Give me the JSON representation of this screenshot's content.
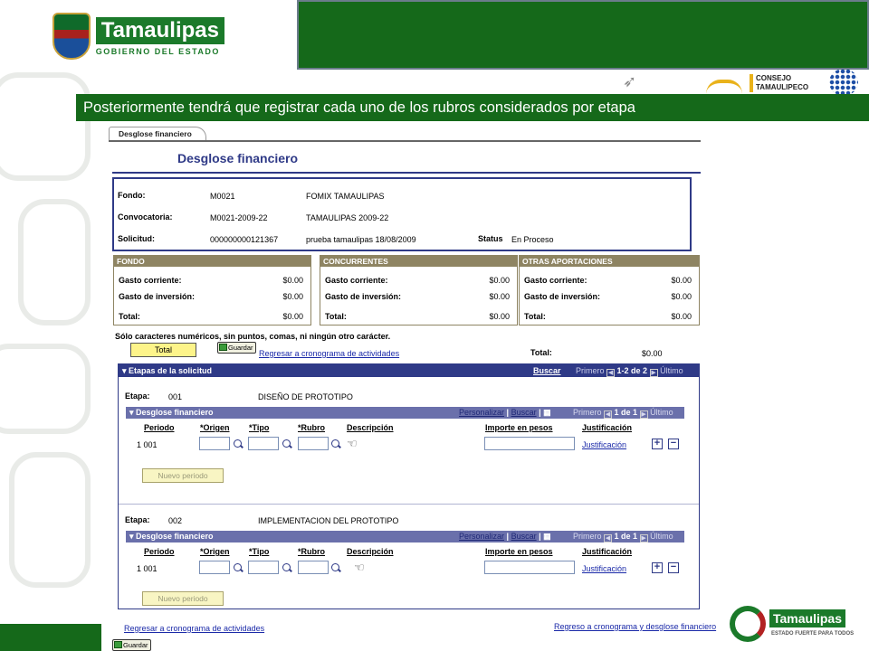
{
  "header": {
    "logo_name": "Tamaulipas",
    "logo_sub": "GOBIERNO DEL ESTADO",
    "sponsor_text": "CONSEJO TAMAULIPECO",
    "banner": "Posteriormente tendrá que registrar cada uno de los rubros considerados por etapa"
  },
  "tab": {
    "label": "Desglose financiero"
  },
  "page": {
    "title": "Desglose financiero"
  },
  "info": {
    "fondo_label": "Fondo:",
    "fondo_code": "M0021",
    "fondo_name": "FOMIX TAMAULIPAS",
    "conv_label": "Convocatoria:",
    "conv_code": "M0021-2009-22",
    "conv_name": "TAMAULIPAS 2009-22",
    "sol_label": "Solicitud:",
    "sol_code": "000000000121367",
    "sol_name": "prueba tamaulipas 18/08/2009",
    "status_label": "Status",
    "status_value": "En Proceso"
  },
  "summaries": [
    {
      "title": "FONDO",
      "gc_label": "Gasto corriente:",
      "gc": "$0.00",
      "gi_label": "Gasto de inversión:",
      "gi": "$0.00",
      "tot_label": "Total:",
      "tot": "$0.00"
    },
    {
      "title": "CONCURRENTES",
      "gc_label": "Gasto corriente:",
      "gc": "$0.00",
      "gi_label": "Gasto de inversión:",
      "gi": "$0.00",
      "tot_label": "Total:",
      "tot": "$0.00"
    },
    {
      "title": "OTRAS APORTACIONES",
      "gc_label": "Gasto corriente:",
      "gc": "$0.00",
      "gi_label": "Gasto de inversión:",
      "gi": "$0.00",
      "tot_label": "Total:",
      "tot": "$0.00"
    }
  ],
  "notice": "Sólo caracteres numéricos, sin puntos, comas, ni ningún otro carácter.",
  "actions": {
    "total_button": "Total",
    "save_button": "Guardar",
    "return_link": "Regresar a cronograma de actividades",
    "total_label": "Total:",
    "total_value": "$0.00"
  },
  "etapas": {
    "header": "Etapas de la solicitud",
    "buscar": "Buscar",
    "primero": "Primero",
    "range": "1-2 de 2",
    "ultimo": "Último",
    "stages": [
      {
        "etapa_label": "Etapa:",
        "code": "001",
        "name": "DISEÑO DE PROTOTIPO",
        "grid_title": "Desglose financiero",
        "personalizar": "Personalizar",
        "buscar": "Buscar",
        "primero": "Primero",
        "range": "1 de 1",
        "ultimo": "Último",
        "cols": {
          "periodo": "Periodo",
          "origen": "*Origen",
          "tipo": "*Tipo",
          "rubro": "*Rubro",
          "descripcion": "Descripción",
          "importe": "Importe en pesos",
          "justificacion": "Justificación"
        },
        "row_periodo": "1 001",
        "justificacion_link": "Justificación",
        "nuevo": "Nuevo periodo"
      },
      {
        "etapa_label": "Etapa:",
        "code": "002",
        "name": "IMPLEMENTACION DEL PROTOTIPO",
        "grid_title": "Desglose financiero",
        "personalizar": "Personalizar",
        "buscar": "Buscar",
        "primero": "Primero",
        "range": "1 de 1",
        "ultimo": "Último",
        "cols": {
          "periodo": "Periodo",
          "origen": "*Origen",
          "tipo": "*Tipo",
          "rubro": "*Rubro",
          "descripcion": "Descripción",
          "importe": "Importe en pesos",
          "justificacion": "Justificación"
        },
        "row_periodo": "1 001",
        "justificacion_link": "Justificación",
        "nuevo": "Nuevo periodo"
      }
    ]
  },
  "footer": {
    "return_link": "Regresar a cronograma de actividades",
    "regreso_link": "Regreso a cronograma y desglose financiero",
    "save_button": "Guardar",
    "logo_name": "Tamaulipas",
    "logo_sub": "ESTADO FUERTE PARA TODOS"
  },
  "colors": {
    "brand_green": "#15691a",
    "peoplesoft_blue": "#2f3a87",
    "summary_header": "#8e8462"
  }
}
